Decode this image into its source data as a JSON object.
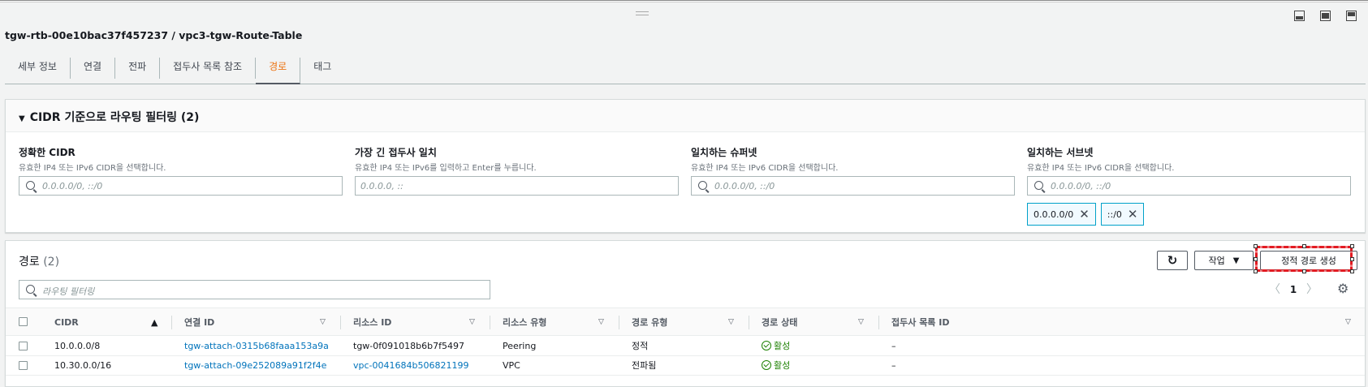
{
  "header": {
    "title": "tgw-rtb-00e10bac37f457237 / vpc3-tgw-Route-Table"
  },
  "tabs": [
    {
      "label": "세부 정보",
      "active": false
    },
    {
      "label": "연결",
      "active": false
    },
    {
      "label": "전파",
      "active": false
    },
    {
      "label": "접두사 목록 참조",
      "active": false
    },
    {
      "label": "경로",
      "active": true
    },
    {
      "label": "태그",
      "active": false
    }
  ],
  "filter": {
    "title": "CIDR 기준으로 라우팅 필터링 (2)",
    "groups": [
      {
        "label": "정확한 CIDR",
        "description": "유효한 IP4 또는 IPv6 CIDR을 선택합니다.",
        "placeholder": "0.0.0.0/0, ::/0"
      },
      {
        "label": "가장 긴 접두사 일치",
        "description": "유효한 IP4 또는 IPv6를 입력하고 Enter를 누릅니다.",
        "placeholder": "0.0.0.0, ::"
      },
      {
        "label": "일치하는 슈퍼넷",
        "description": "유효한 IP4 또는 IPv6 CIDR을 선택합니다.",
        "placeholder": "0.0.0.0/0, ::/0"
      },
      {
        "label": "일치하는 서브넷",
        "description": "유효한 IP4 또는 IPv6 CIDR을 선택합니다.",
        "placeholder": "0.0.0.0/0, ::/0"
      }
    ],
    "tokens": [
      "0.0.0.0/0",
      "::/0"
    ]
  },
  "routes": {
    "title": "경로",
    "count": "(2)",
    "actions_label": "작업",
    "create_label": "정적 경로 생성",
    "search_placeholder": "라우팅 필터링",
    "page": "1",
    "columns": [
      "CIDR",
      "연결 ID",
      "리소스 ID",
      "리소스 유형",
      "경로 유형",
      "경로 상태",
      "접두사 목록 ID"
    ],
    "rows": [
      {
        "cidr": "10.0.0.0/8",
        "attachment": "tgw-attach-0315b68faaa153a9a",
        "resource_id": "tgw-0f091018b6b7f5497",
        "resource_type": "Peering",
        "route_type": "정적",
        "state": "활성",
        "prefix_list": "–"
      },
      {
        "cidr": "10.30.0.0/16",
        "attachment": "tgw-attach-09e252089a91f2f4e",
        "resource_id": "vpc-0041684b506821199",
        "resource_type": "VPC",
        "route_type": "전파됨",
        "state": "활성",
        "prefix_list": "–"
      }
    ]
  },
  "colors": {
    "accent": "#ec7211",
    "link": "#0073bb",
    "success": "#1d8102",
    "highlight": "#e21b23"
  }
}
